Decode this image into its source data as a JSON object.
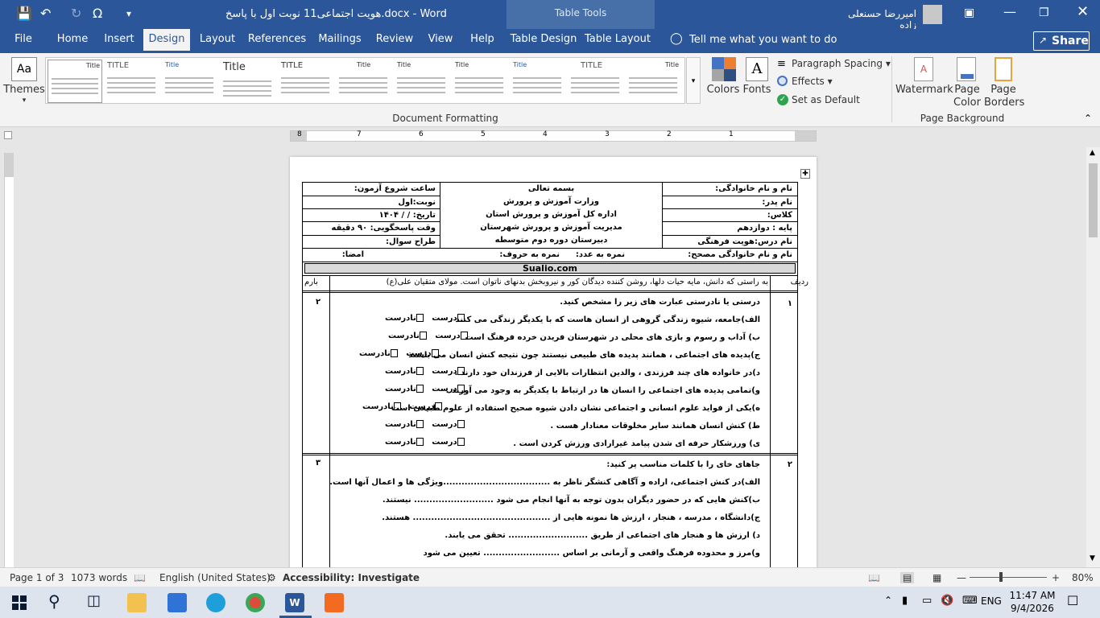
{
  "title_bar": {
    "document_title": "هویت اجتماعی11 نوبت اول با پاسخ.docx - Word",
    "table_tools_label": "Table Tools",
    "user_name": "امیررضا حسنعلی زاده"
  },
  "tabs": [
    "File",
    "Home",
    "Insert",
    "Design",
    "Layout",
    "References",
    "Mailings",
    "Review",
    "View",
    "Help",
    "Table Design",
    "Table Layout"
  ],
  "tell_me": "Tell me what you want to do",
  "share_label": "Share",
  "ribbon": {
    "themes_label": "Themes",
    "colors_label": "Colors",
    "fonts_label": "Fonts",
    "paragraph_spacing_label": "Paragraph Spacing",
    "effects_label": "Effects",
    "set_as_default_label": "Set as Default",
    "document_formatting_label": "Document Formatting",
    "watermark_label": "Watermark",
    "page_color_label_1": "Page",
    "page_color_label_2": "Color",
    "page_borders_label_1": "Page",
    "page_borders_label_2": "Borders",
    "page_background_label": "Page Background",
    "style_titles": [
      "Title",
      "TITLE",
      "Title",
      "Title",
      "TITLE",
      "Title",
      "Title",
      "Title",
      "Title",
      "TITLE",
      "Title"
    ]
  },
  "ruler_numbers": [
    "8",
    "7",
    "6",
    "5",
    "4",
    "3",
    "2",
    "1"
  ],
  "document": {
    "header_right": [
      "نام و نام خانوادگی:",
      "نام پدر:",
      "کلاس:",
      "پایه : دوازدهم",
      "نام درس:هویت فرهنگی"
    ],
    "header_center": [
      "بسمه تعالی",
      "وزارت آموزش و پرورش",
      "اداره کل آموزش و پرورش استان",
      "مدیریت آموزش و پرورش شهرستان",
      "دبیرستان دوره دوم متوسطه"
    ],
    "header_left": [
      "ساعت شروع آزمون:",
      "نوبت:اول",
      "تاریخ:    /    /   ۱۴۰۴",
      "وقت پاسخگویی: ۹۰ دقیقه",
      "طراح سوال:"
    ],
    "grader_row": {
      "name": "نام و نام خانوادگی مصحح:",
      "score_number": "نمره به عدد:",
      "score_letters": "نمره به حروف:",
      "signature": "امضا:"
    },
    "site_banner": "Sualio.com",
    "quote_row": {
      "row_label": "ردیف",
      "quote": "به راستی که دانش، مایه حیات دلها، روشن کننده دیدگان کور و نیروبخش بدنهای ناتوان است. مولای متقیان علی(ع)",
      "score_label": "بارم"
    },
    "q1": {
      "number": "۱",
      "score": "۲",
      "instruction": "درستی یا نادرستی عبارت های زیر را مشخص کنید.",
      "items": [
        "الف)جامعه، شیوه زندگی گروهی از انسان هاست که با یکدیگر زندگی می کنند .",
        "ب) آداب و رسوم و بازی های محلی در شهرستان فریدن خرده فرهنگ است",
        "ج)پدیده های اجتماعی ، همانند پدیده های طبیعی نیستند چون نتیجه کنش انسان می باشند",
        "د)در خانواده های چند فرزندی ، والدین انتظارات بالایی از فرزندان خود دارند .",
        "و)تمامی پدیده های اجتماعی را انسان ها در ارتباط با یکدیگر به وجود می آورند .",
        "ه)یکی از فواید علوم انسانی و اجتماعی نشان دادن شیوه صحیح استفاده از علوم طبیعی است",
        "ط) کنش انسان همانند سایر مخلوقات معنادار هست .",
        "ی) ورزشکار حرفه ای شدن پیامد غیرارادی ورزش کردن است ."
      ],
      "true_label": "درست",
      "false_label": "نادرست"
    },
    "q2": {
      "number": "۲",
      "score": "۳",
      "instruction": "جاهای خای را با کلمات مناسب پر کنید:",
      "items": [
        "الف)در کنش اجتماعی، اراده و آگاهی کنشگر ناظر به ...................................ویژگی ها و اعمال آنها است.",
        "ب)کنش هایی که در حضور دیگران بدون توجه به آنها انجام می شود .......................... نیستند.",
        "ج)دانشگاه ، مدرسه ، هنجار ، ارزش ها نمونه هایی از ............................................. هستند.",
        "د) ارزش ها و هنجار های اجتماعی از طریق .......................... تحقق می یابند.",
        "و)مرز و محدوده فرهنگ واقعی و آرمانی بر اساس ......................... تعیین می شود"
      ]
    }
  },
  "status_bar": {
    "page": "Page 1 of 3",
    "words": "1073 words",
    "language": "English (United States)",
    "accessibility": "Accessibility: Investigate",
    "zoom": "80%"
  },
  "taskbar": {
    "language": "ENG",
    "time": "11:47 AM",
    "date": "9/4/2026"
  }
}
